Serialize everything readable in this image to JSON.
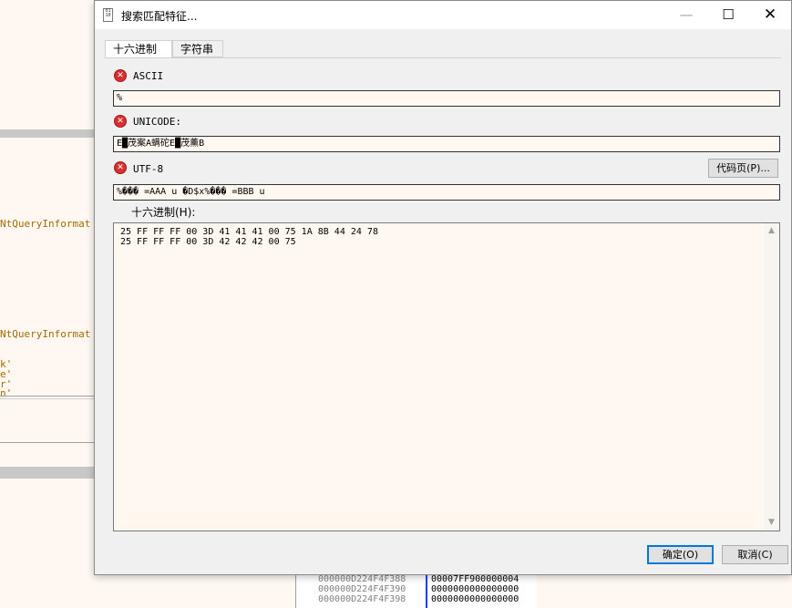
{
  "background": {
    "code_lines": [
      "NtQueryInformat",
      "NtQueryInformat"
    ],
    "code_fragments": [
      "k'",
      "e'",
      "r'",
      "n'"
    ],
    "memory_rows": [
      {
        "addr": "000000D224F4F388",
        "val": "00007FF900000004"
      },
      {
        "addr": "000000D224F4F390",
        "val": "0000000000000000"
      },
      {
        "addr": "000000D224F4F398",
        "val": "0000000000000000"
      }
    ]
  },
  "dialog": {
    "title": "搜索匹配特征...",
    "icon_text": "01\n10",
    "tabs": [
      {
        "label": "十六进制",
        "active": true
      },
      {
        "label": "字符串",
        "active": false
      }
    ],
    "ascii": {
      "label": "ASCII",
      "value": "%"
    },
    "unicode": {
      "label": "UNICODE:",
      "value": "E█茂案A螨砣E█茂薰B"
    },
    "utf8": {
      "label": "UTF-8",
      "value": "%��� =AAA u �D$x%��� =BBB u"
    },
    "codepage_button": "代码页(P)...",
    "hex_label": "十六进制(H):",
    "hex_lines": [
      "25 FF FF FF 00 3D 41 41 41 00 75 1A 8B 44 24 78",
      "25 FF FF FF 00 3D 42 42 42 00 75"
    ],
    "ok_button": "确定(O)",
    "cancel_button": "取消(C)"
  },
  "colors": {
    "error_icon": "#d83030",
    "default_button_border": "#0078d7",
    "field_background": "#fff8f0"
  }
}
